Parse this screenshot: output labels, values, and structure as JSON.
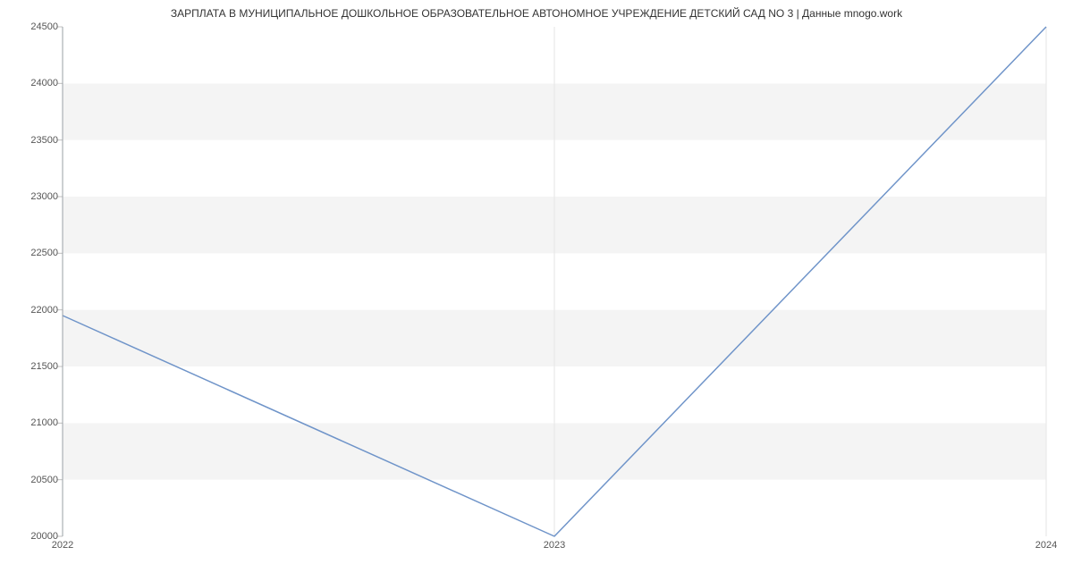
{
  "chart_data": {
    "type": "line",
    "title": "ЗАРПЛАТА В МУНИЦИПАЛЬНОЕ ДОШКОЛЬНОЕ ОБРАЗОВАТЕЛЬНОЕ АВТОНОМНОЕ УЧРЕЖДЕНИЕ ДЕТСКИЙ САД NO 3 | Данные mnogo.work",
    "x": [
      2022,
      2023,
      2024
    ],
    "values": [
      21950,
      20000,
      24500
    ],
    "x_ticks": [
      2022,
      2023,
      2024
    ],
    "y_ticks": [
      20000,
      20500,
      21000,
      21500,
      22000,
      22500,
      23000,
      23500,
      24000,
      24500
    ],
    "xlim": [
      2022,
      2024
    ],
    "ylim": [
      20000,
      24500
    ],
    "line_color": "#6f94c9",
    "band_fill": "#f4f4f4",
    "axis_color": "#9aa0a6",
    "tick_color": "#c0c0c0"
  }
}
